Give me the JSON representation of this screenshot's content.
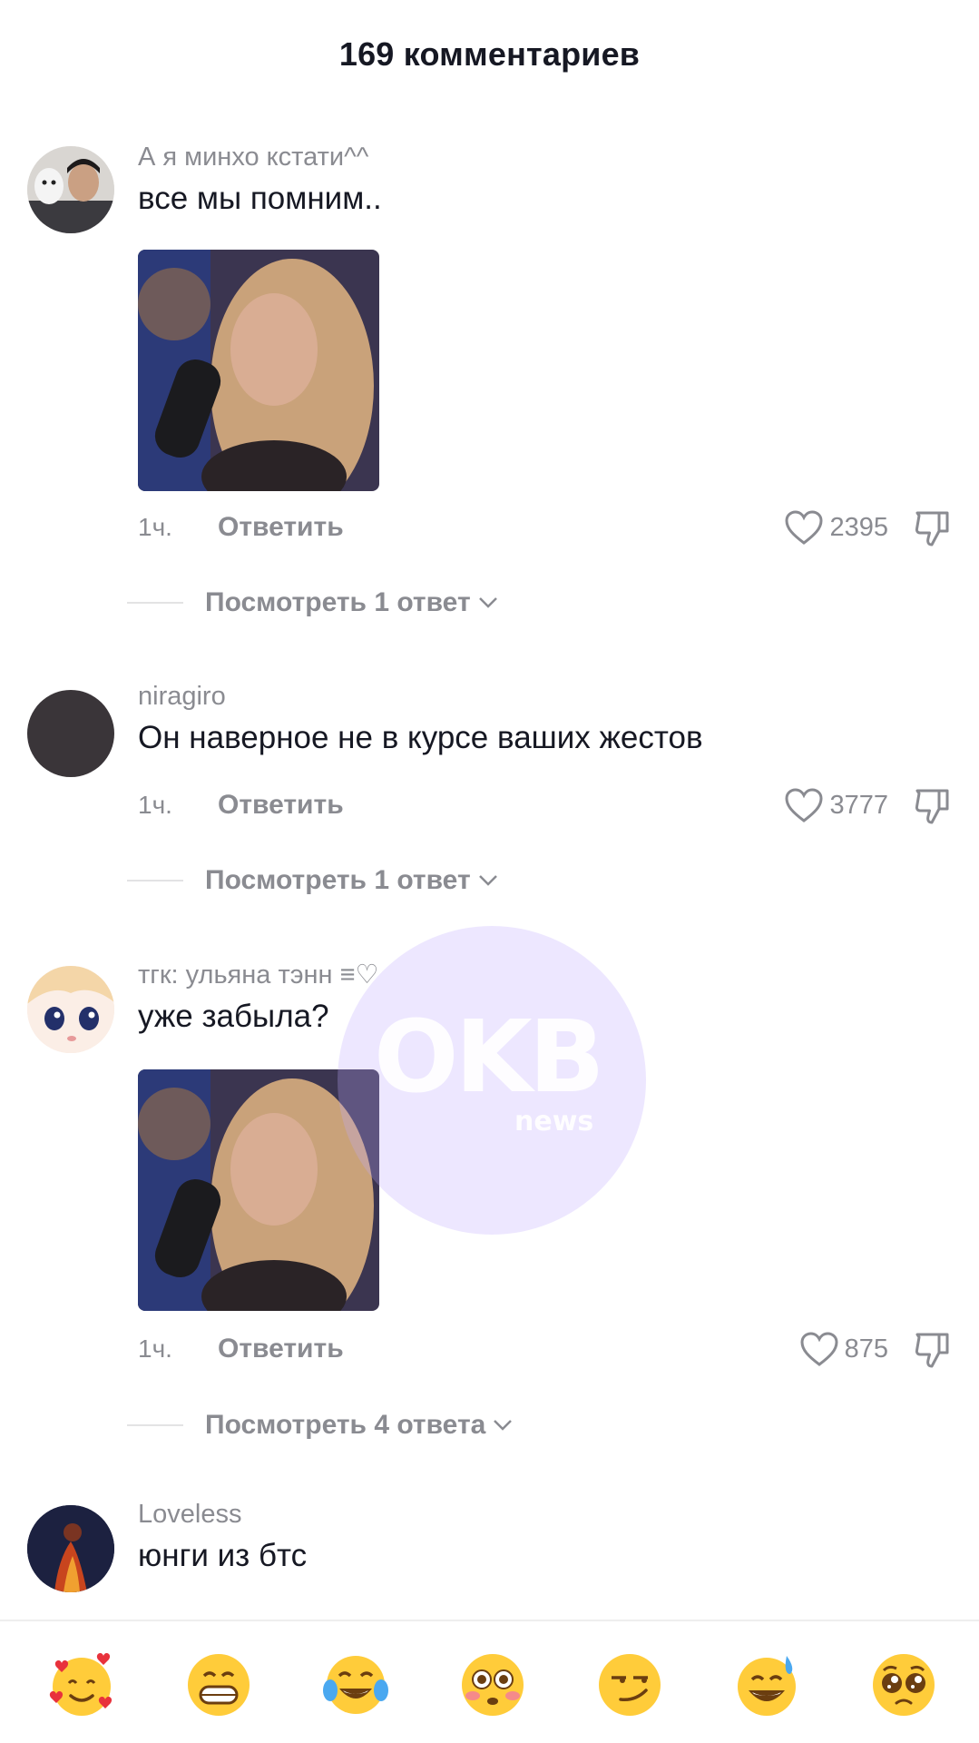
{
  "header": {
    "title": "169 комментариев"
  },
  "comments": [
    {
      "username": "А я минхо кстати^^",
      "text": "все мы помним..",
      "time": "1ч.",
      "reply_label": "Ответить",
      "likes": "2395",
      "view_replies": "Посмотреть 1 ответ",
      "has_image": true
    },
    {
      "username": "niragiro",
      "text": "Он наверное не в курсе ваших жестов",
      "time": "1ч.",
      "reply_label": "Ответить",
      "likes": "3777",
      "view_replies": "Посмотреть 1 ответ",
      "has_image": false
    },
    {
      "username": "тгк: ульяна тэнн ≡♡",
      "text": "уже забыла?",
      "time": "1ч.",
      "reply_label": "Ответить",
      "likes": "875",
      "view_replies": "Посмотреть 4 ответа",
      "has_image": true
    },
    {
      "username": "Loveless",
      "text": "юнги из бтс",
      "has_image": false
    }
  ],
  "watermark": {
    "text": "OKB",
    "sub": "news"
  },
  "emoji_bar": [
    "smiling-face-with-hearts",
    "grinning-face",
    "face-with-tears-of-joy",
    "flushed-face",
    "smirking-face",
    "grinning-face-with-sweat",
    "pleading-face"
  ],
  "colors": {
    "muted": "#8a8b91",
    "text": "#161823",
    "emoji_yellow": "#ffcc3a"
  }
}
